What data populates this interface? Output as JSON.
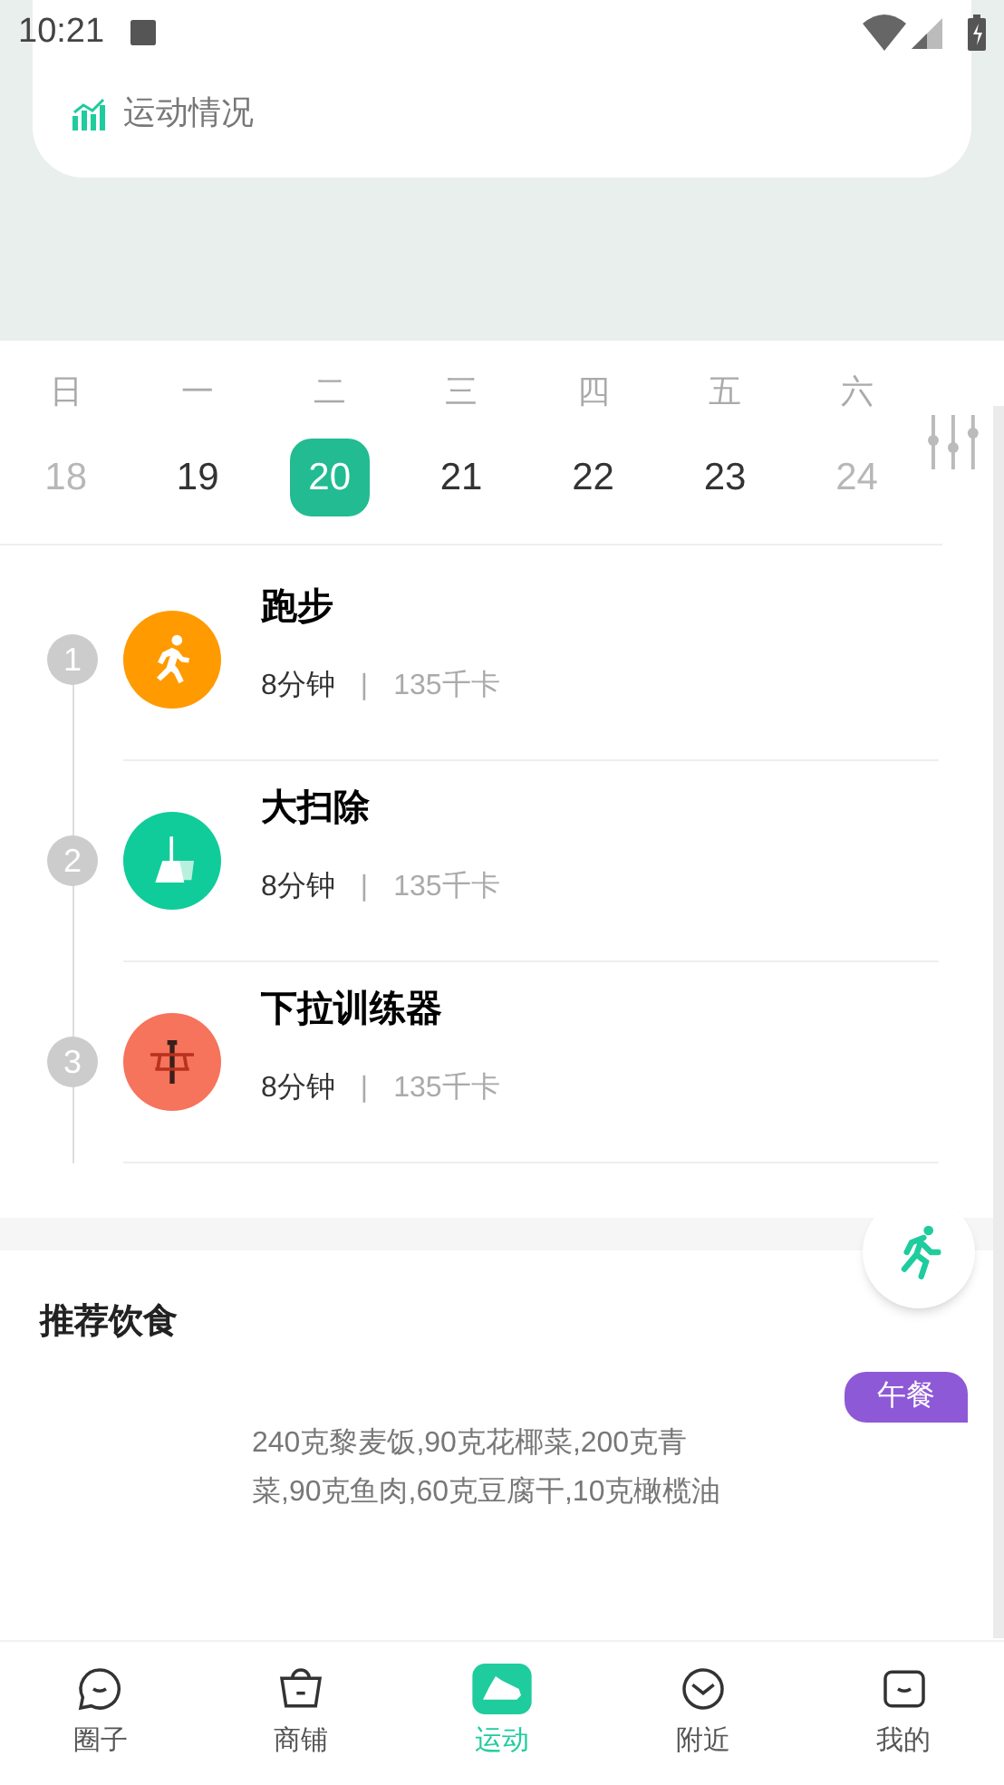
{
  "status_bar": {
    "time": "10:21"
  },
  "summary_card": {
    "link": "运动情况"
  },
  "week": {
    "days": [
      {
        "weekday": "日",
        "date": "18",
        "disabled": true,
        "selected": false
      },
      {
        "weekday": "一",
        "date": "19",
        "disabled": false,
        "selected": false
      },
      {
        "weekday": "二",
        "date": "20",
        "disabled": false,
        "selected": true
      },
      {
        "weekday": "三",
        "date": "21",
        "disabled": false,
        "selected": false
      },
      {
        "weekday": "四",
        "date": "22",
        "disabled": false,
        "selected": false
      },
      {
        "weekday": "五",
        "date": "23",
        "disabled": false,
        "selected": false
      },
      {
        "weekday": "六",
        "date": "24",
        "disabled": true,
        "selected": false
      }
    ]
  },
  "exercises": [
    {
      "number": "1",
      "title": "跑步",
      "duration": "8分钟",
      "separator": "|",
      "calories": "135千卡",
      "color": "#ff9a00"
    },
    {
      "number": "2",
      "title": "大扫除",
      "duration": "8分钟",
      "separator": "|",
      "calories": "135千卡",
      "color": "#10cc9a"
    },
    {
      "number": "3",
      "title": "下拉训练器",
      "duration": "8分钟",
      "separator": "|",
      "calories": "135千卡",
      "color": "#f6735c"
    }
  ],
  "diet": {
    "title": "推荐饮食",
    "meal": "午餐",
    "foods": "240克黎麦饭,90克花椰菜,200克青菜,90克鱼肉,60克豆腐干,10克橄榄油"
  },
  "tab_bar": [
    {
      "label": "圈子",
      "selected": false
    },
    {
      "label": "商铺",
      "selected": false
    },
    {
      "label": "运动",
      "selected": true
    },
    {
      "label": "附近",
      "selected": false
    },
    {
      "label": "我的",
      "selected": false
    }
  ]
}
